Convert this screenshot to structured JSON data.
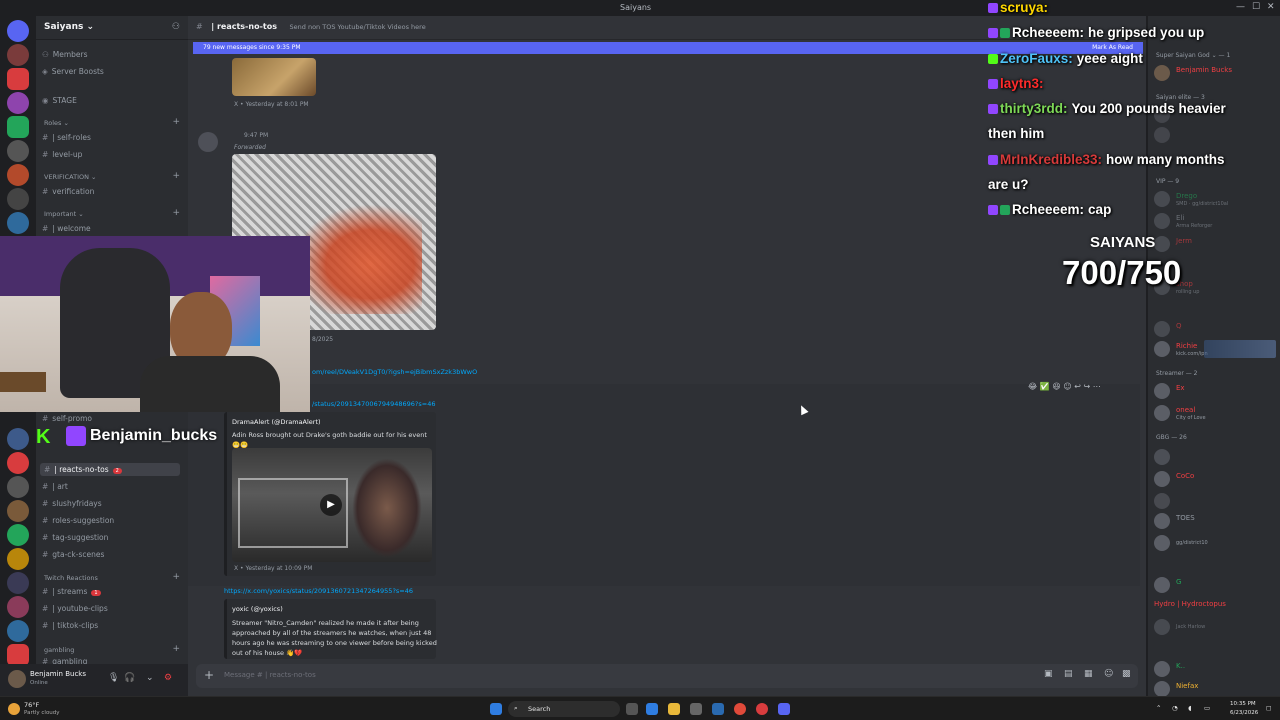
{
  "window": {
    "title": "Saiyans"
  },
  "server": {
    "name": "Saiyans ⌄"
  },
  "channels": {
    "top_items": [
      "Members",
      "Server Boosts"
    ],
    "stage": "STAGE",
    "roles_cat": "Roles ⌄",
    "roles": [
      {
        "label": "| self-roles"
      },
      {
        "label": "level-up"
      }
    ],
    "verification_cat": "VERIFICATION ⌄",
    "verification": {
      "label": "verification"
    },
    "important_cat": "Important ⌄",
    "welcome": {
      "label": "| welcome"
    },
    "lower": [
      {
        "label": "self-promo"
      },
      {
        "label": "| reacts-no-tos",
        "badge": "2"
      },
      {
        "label": "| art"
      },
      {
        "label": "slushyfridays"
      },
      {
        "label": "roles-suggestion"
      },
      {
        "label": "tag-suggestion"
      },
      {
        "label": "gta-ck-scenes"
      }
    ],
    "twitch_cat": "Twitch Reactions",
    "twitch": [
      {
        "label": "| streams",
        "badge": "1"
      },
      {
        "label": "| youtube-clips"
      },
      {
        "label": "| tiktok-clips"
      }
    ],
    "gambling_cat": "gambling",
    "gambling": "gambling"
  },
  "user": {
    "name": "Benjamin Bucks",
    "status": "Online"
  },
  "header": {
    "channel": "| reacts-no-tos",
    "topic": "Send non TOS Youtube/Tiktok Videos here"
  },
  "newbar": {
    "text": "79 new messages since 9:35 PM",
    "mark": "Mark As Read"
  },
  "messages": {
    "embed1_footer": "X • Yesterday at 8:01 PM",
    "m2_time": "9:47 PM",
    "m2_forwarded": "Forwarded",
    "m2_date": "8/2025",
    "link1": "om/reel/DVeakV1DgT0/?igsh=ejBibmSxZzk3bWwO",
    "link2": "/status/2091347006794948696?s=46",
    "embed2_author": "DramaAlert (@DramaAlert)",
    "embed2_text": "Adin Ross brought out Drake's goth baddie out for his event 😬😬",
    "embed2_footer": "X • Yesterday at 10:09 PM",
    "link3": "https://x.com/yoxics/status/2091360721347264955?s=46",
    "embed3_author": "yoxic (@yoxics)",
    "embed3_text": "Streamer \"Nitro_Camden\" realized he made it after being approached by all of the streamers he watches, when just 48 hours ago he was streaming to one viewer before being kicked out of his house 👋💔"
  },
  "composer": {
    "placeholder": "Message # | reacts-no-tos"
  },
  "members": {
    "cats": [
      "Super Saiyan God ⌄ — 1",
      "Saiyan elite — 3",
      "VIP — 9",
      "Streamer — 2",
      "GBG — 26"
    ],
    "list": [
      {
        "name": "Benjamin Bucks",
        "color": "#f23f43",
        "sub": ""
      },
      {
        "name": "Drego",
        "color": "#23a55a",
        "sub": "SMD · gg/district10al"
      },
      {
        "name": "Eli",
        "color": "#949ba4",
        "sub": "Arma Reforger"
      },
      {
        "name": "Jerm",
        "color": "#f23f43",
        "sub": ""
      },
      {
        "name": "shop",
        "color": "#f23f43",
        "sub": "rolling up"
      },
      {
        "name": "Q",
        "color": "#f23f43",
        "sub": ""
      },
      {
        "name": "Richie",
        "color": "#f23f43",
        "sub": "kick.com/ipn"
      },
      {
        "name": "Ex",
        "color": "#f23f43",
        "sub": ""
      },
      {
        "name": "oneal",
        "color": "#f23f43",
        "sub": "City of Love"
      },
      {
        "name": "CoCo",
        "color": "#f23f43",
        "sub": ""
      },
      {
        "name": "TOES",
        "color": "#949ba4",
        "sub": ""
      },
      {
        "name": "G",
        "color": "#23a55a",
        "sub": "gg/district10"
      },
      {
        "name": "Hydro | Hydroctopus",
        "color": "#f23f43",
        "sub": ""
      },
      {
        "name": "Jack Harlow",
        "color": "#949ba4",
        "sub": ""
      },
      {
        "name": "K..",
        "color": "#23a55a",
        "sub": "PAID"
      },
      {
        "name": "Niefax",
        "color": "#f0b232",
        "sub": "MODC"
      }
    ]
  },
  "overlay": {
    "chat": [
      {
        "user": "scruya:",
        "ucolor": "#ffd700",
        "msg": ""
      },
      {
        "user": "Rcheeeem:",
        "ucolor": "#ffffff",
        "msg": "he gripsed you up"
      },
      {
        "user": "ZeroFauxs:",
        "ucolor": "#4fc3f7",
        "msg": "yeee aight"
      },
      {
        "user": "laytn3:",
        "ucolor": "#ff2b2b",
        "msg": ""
      },
      {
        "user": "thirty3rdd:",
        "ucolor": "#7ed957",
        "msg": "You 200 pounds heavier"
      },
      {
        "user": "",
        "ucolor": "#ffffff",
        "msg": "then him"
      },
      {
        "user": "MrInKredible33:",
        "ucolor": "#d63a3a",
        "msg": "how many months"
      },
      {
        "user": "",
        "ucolor": "#ffffff",
        "msg": "are u?"
      },
      {
        "user": "Rcheeeem:",
        "ucolor": "#ffffff",
        "msg": "cap"
      }
    ],
    "goal_title": "SAIYANS",
    "goal_value": "700/750",
    "streamer_tag": "Benjamin_bucks",
    "kick_letter": "K"
  },
  "taskbar": {
    "weather_temp": "76°F",
    "weather_desc": "Partly cloudy",
    "search": "Search",
    "time": "10:35 PM",
    "date": "6/23/2026"
  },
  "colors": {
    "accent": "#5865f2",
    "link": "#00a8fc",
    "kick": "#53fc18",
    "twitch": "#9146ff"
  }
}
